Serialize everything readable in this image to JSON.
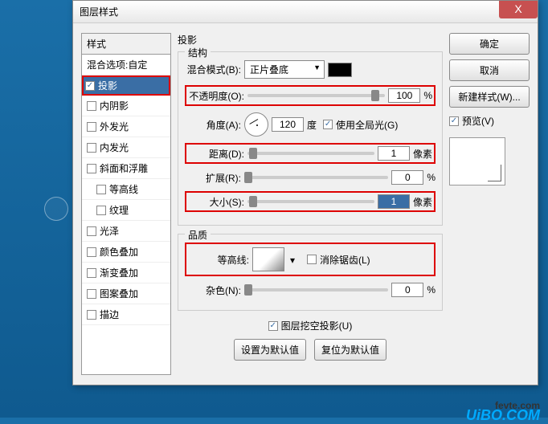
{
  "dialog": {
    "title": "图层样式",
    "close": "X"
  },
  "styles": {
    "header": "样式",
    "blend_options": "混合选项:自定",
    "items": [
      {
        "label": "投影",
        "checked": true,
        "selected": true
      },
      {
        "label": "内阴影",
        "checked": false
      },
      {
        "label": "外发光",
        "checked": false
      },
      {
        "label": "内发光",
        "checked": false
      },
      {
        "label": "斜面和浮雕",
        "checked": false
      },
      {
        "label": "等高线",
        "checked": false,
        "indent": true
      },
      {
        "label": "纹理",
        "checked": false,
        "indent": true
      },
      {
        "label": "光泽",
        "checked": false
      },
      {
        "label": "颜色叠加",
        "checked": false
      },
      {
        "label": "渐变叠加",
        "checked": false
      },
      {
        "label": "图案叠加",
        "checked": false
      },
      {
        "label": "描边",
        "checked": false
      }
    ]
  },
  "main": {
    "panel_title": "投影",
    "structure": {
      "title": "结构",
      "blend_mode_label": "混合模式(B):",
      "blend_mode_value": "正片叠底",
      "opacity_label": "不透明度(O):",
      "opacity_value": "100",
      "opacity_unit": "%",
      "angle_label": "角度(A):",
      "angle_value": "120",
      "angle_unit": "度",
      "global_light": "使用全局光(G)",
      "distance_label": "距离(D):",
      "distance_value": "1",
      "distance_unit": "像素",
      "spread_label": "扩展(R):",
      "spread_value": "0",
      "spread_unit": "%",
      "size_label": "大小(S):",
      "size_value": "1",
      "size_unit": "像素"
    },
    "quality": {
      "title": "品质",
      "contour_label": "等高线:",
      "antialias": "消除锯齿(L)",
      "noise_label": "杂色(N):",
      "noise_value": "0",
      "noise_unit": "%"
    },
    "knockout": "图层挖空投影(U)",
    "set_default": "设置为默认值",
    "reset_default": "复位为默认值"
  },
  "buttons": {
    "ok": "确定",
    "cancel": "取消",
    "new_style": "新建样式(W)...",
    "preview": "预览(V)"
  },
  "watermark": {
    "line1": "fevte.com",
    "line2": "UiBO.COM"
  }
}
